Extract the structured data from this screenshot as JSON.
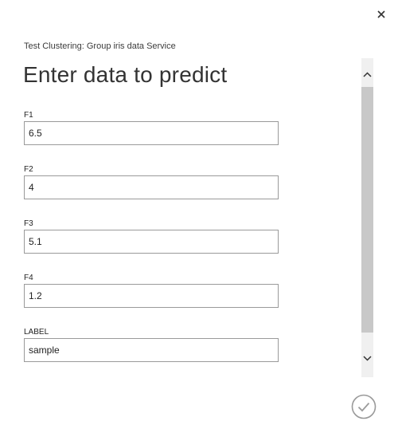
{
  "dialog": {
    "subtitle": "Test Clustering: Group iris data Service",
    "title": "Enter data to predict",
    "close_icon": "close-icon",
    "confirm_icon": "checkmark-circle-icon"
  },
  "fields": [
    {
      "label": "F1",
      "value": "6.5"
    },
    {
      "label": "F2",
      "value": "4"
    },
    {
      "label": "F3",
      "value": "5.1"
    },
    {
      "label": "F4",
      "value": "1.2"
    },
    {
      "label": "LABEL",
      "value": "sample"
    }
  ],
  "scrollbar": {
    "up_icon": "chevron-up-icon",
    "down_icon": "chevron-down-icon"
  },
  "colors": {
    "border": "#9a9a9a",
    "scroll_track": "#f0f0f0",
    "scroll_thumb": "#c8c8c8",
    "icon": "#333333",
    "confirm": "#9a9a9a"
  }
}
